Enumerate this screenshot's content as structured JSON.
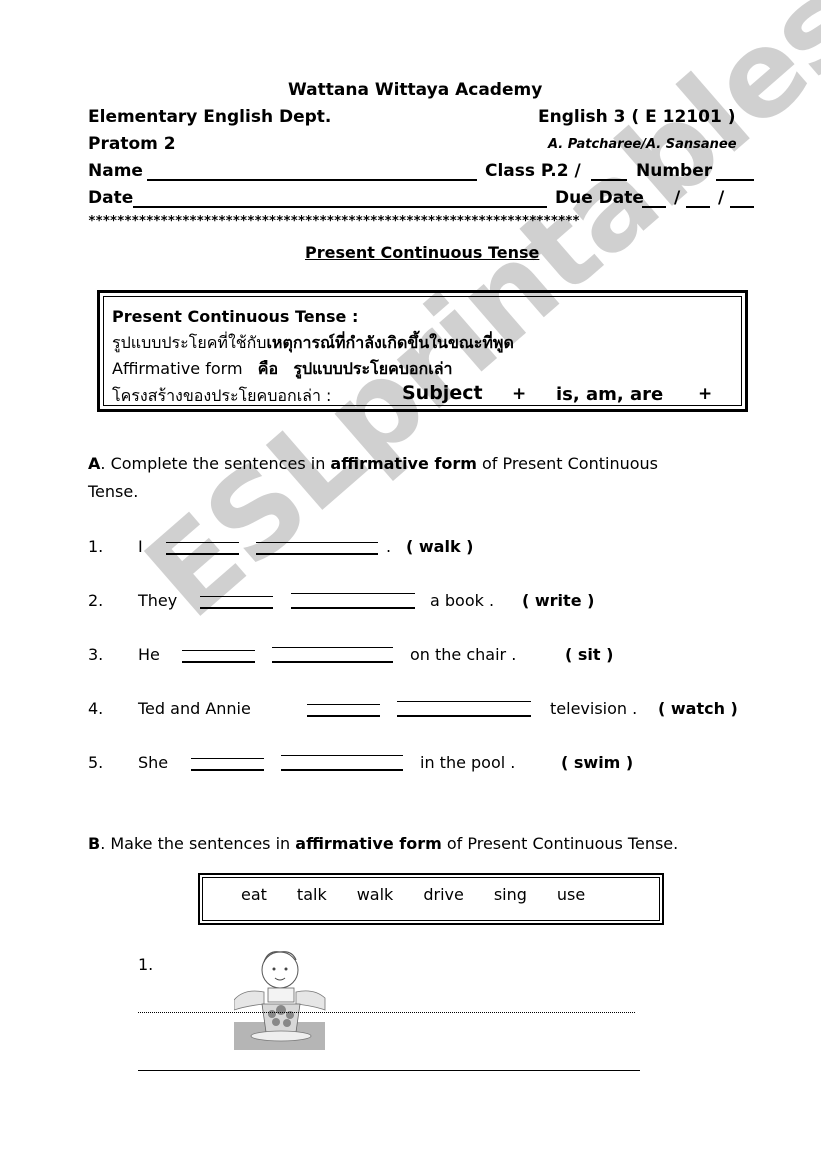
{
  "header": {
    "school": "Wattana  Wittaya  Academy",
    "dept": "Elementary English Dept.",
    "course": "English 3 ( E 12101 )",
    "level": "Pratom 2",
    "teachers": "A. Patcharee/A. Sansanee",
    "name_label": "Name",
    "class_label": "Class P.2 /",
    "number_label": "Number",
    "date_label": "Date",
    "due_label": "Due Date",
    "slash": "/",
    "stars": "********************************************************************"
  },
  "title": "Present Continuous Tense",
  "info_box": {
    "heading": "Present Continuous Tense   :",
    "thai_line_plain": "รูปแบบประโยคที่ใช้กับ",
    "thai_line_bold": "เหตุการณ์ที่กำลังเกิดขึ้นในขณะที่พูด",
    "affirm_label": "Affirmative form",
    "affirm_thai_is": "คือ",
    "affirm_thai_def": "รูปแบบประโยคบอกเล่า",
    "structure_label": "โครงสร้างของประโยคบอกเล่า  :",
    "structure_subject": "Subject",
    "structure_plus1": "+",
    "structure_verb": "is, am, are",
    "structure_plus2": "+"
  },
  "section_a": {
    "letter": "A",
    "instruction_pre": ". Complete the sentences in ",
    "instruction_bold": "affirmative  form",
    "instruction_post": " of Present Continuous",
    "instruction_line2": "Tense.",
    "items": [
      {
        "num": "1.",
        "subject": "I",
        "rest": ".",
        "verb": "( walk )"
      },
      {
        "num": "2.",
        "subject": "They",
        "rest": "a   book .",
        "verb": "( write )"
      },
      {
        "num": "3.",
        "subject": "He",
        "rest": "on   the   chair .",
        "verb": "( sit )"
      },
      {
        "num": "4.",
        "subject": "Ted   and   Annie",
        "rest": "television .",
        "verb": "( watch )"
      },
      {
        "num": "5.",
        "subject": "She",
        "rest": "in   the   pool .",
        "verb": "( swim )"
      }
    ]
  },
  "section_b": {
    "letter": "B",
    "instruction_pre": ". Make the sentences in ",
    "instruction_bold": "affirmative  form",
    "instruction_post": " of Present Continuous Tense.",
    "word_bank": [
      "eat",
      "talk",
      "walk",
      "drive",
      "sing",
      "use"
    ],
    "items": [
      {
        "num": "1.",
        "picture": "child-eating-salad-illustration"
      }
    ]
  },
  "watermark": "ESLprintables.com"
}
